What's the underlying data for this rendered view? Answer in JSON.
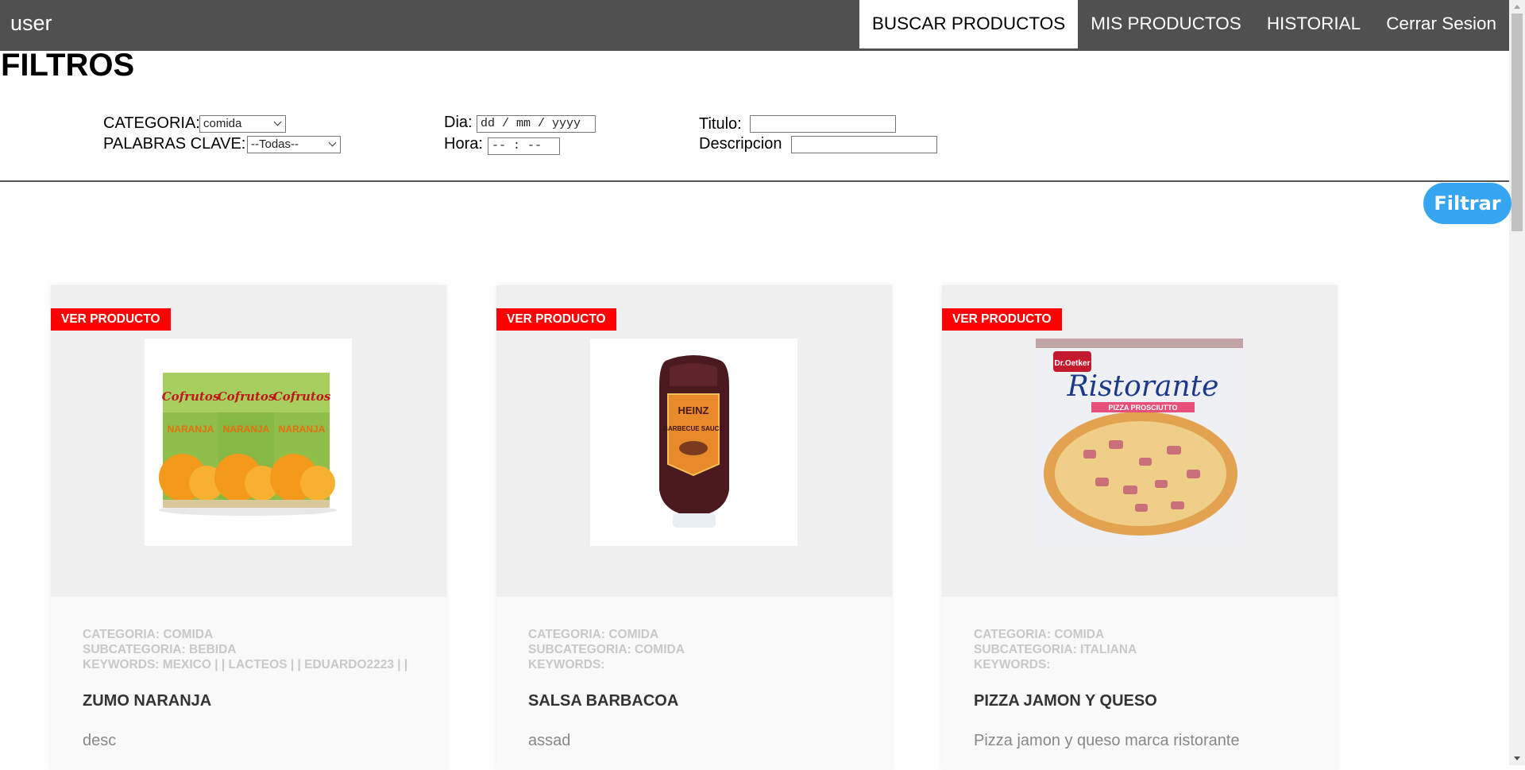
{
  "nav": {
    "brand": "user",
    "links": [
      "BUSCAR PRODUCTOS",
      "MIS PRODUCTOS",
      "HISTORIAL",
      "Cerrar Sesion"
    ],
    "active_index": 0
  },
  "filters": {
    "title": "FILTROS",
    "categoria_label": "CATEGORIA:",
    "categoria_value": "comida",
    "palabras_label": "PALABRAS CLAVE:",
    "palabras_value": "--Todas--",
    "dia_label": "Dia:",
    "dia_value": "dd / mm / yyyy",
    "hora_label": "Hora:",
    "hora_value": "-- : --",
    "titulo_label": "Titulo:",
    "titulo_value": "",
    "descripcion_label": "Descripcion",
    "descripcion_value": "",
    "button": "Filtrar"
  },
  "products": [
    {
      "action": "VER PRODUCTO",
      "categoria": "CATEGORIA: COMIDA",
      "subcategoria": "SUBCATEGORIA: BEBIDA",
      "keywords": "KEYWORDS: MEXICO | | LACTEOS | | EDUARDO2223 | |",
      "title": "ZUMO NARANJA",
      "desc": "desc",
      "image": "zumo-naranja-cofrutos",
      "brand_text": "Cofrutos",
      "pack_text": "NARANJA"
    },
    {
      "action": "VER PRODUCTO",
      "categoria": "CATEGORIA: COMIDA",
      "subcategoria": "SUBCATEGORIA: COMIDA",
      "keywords": "KEYWORDS:",
      "title": "SALSA BARBACOA",
      "desc": "assad",
      "image": "heinz-barbecue-sauce",
      "brand_text": "HEINZ",
      "pack_text": "BARBECUE SAUCE"
    },
    {
      "action": "VER PRODUCTO",
      "categoria": "CATEGORIA: COMIDA",
      "subcategoria": "SUBCATEGORIA: ITALIANA",
      "keywords": "KEYWORDS:",
      "title": "PIZZA JAMON Y QUESO",
      "desc": "Pizza jamon y queso marca ristorante",
      "image": "pizza-ristorante",
      "brand_text": "Ristorante",
      "pack_text": "PIZZA PROSCIUTTO"
    }
  ],
  "colors": {
    "navbar": "#505050",
    "filter_button": "#37a6f2",
    "ver_producto": "#ff0000"
  }
}
